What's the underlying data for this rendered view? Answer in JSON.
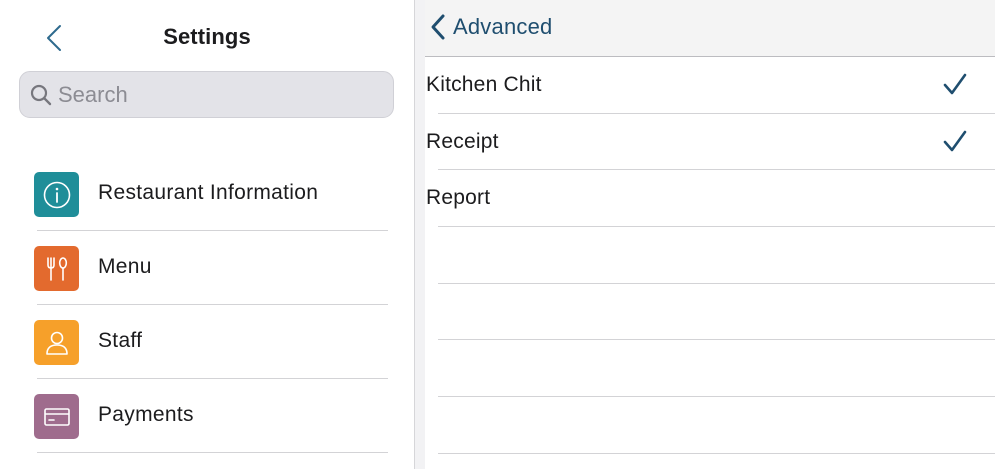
{
  "left_pane": {
    "title": "Settings",
    "search": {
      "placeholder": "Search",
      "value": ""
    },
    "items": [
      {
        "label": "Restaurant Information",
        "icon": "info-icon",
        "color": "#1f8e99"
      },
      {
        "label": "Menu",
        "icon": "utensils-icon",
        "color": "#e36a2e"
      },
      {
        "label": "Staff",
        "icon": "person-icon",
        "color": "#f6a02a"
      },
      {
        "label": "Payments",
        "icon": "card-icon",
        "color": "#9f6c8d"
      }
    ]
  },
  "right_pane": {
    "back_label": "Advanced",
    "rows": [
      {
        "label": "Kitchen Chit",
        "checked": true
      },
      {
        "label": "Receipt",
        "checked": true
      },
      {
        "label": "Report",
        "checked": false
      },
      {
        "label": "",
        "checked": false
      },
      {
        "label": "",
        "checked": false
      },
      {
        "label": "",
        "checked": false
      },
      {
        "label": "",
        "checked": false
      }
    ]
  },
  "colors": {
    "accent": "#1f4e6f",
    "navbar_bg": "#f4f4f4",
    "search_bg": "#e3e3e8"
  }
}
